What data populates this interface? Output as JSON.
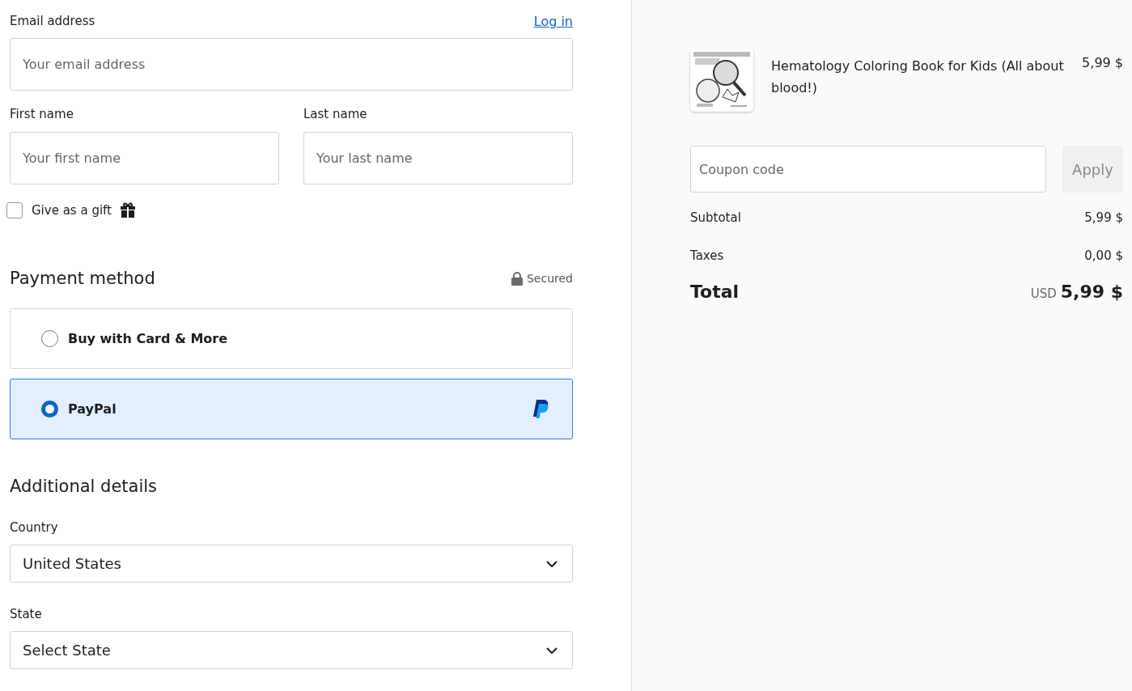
{
  "contact": {
    "email_label": "Email address",
    "login_link": "Log in",
    "email_placeholder": "Your email address",
    "first_name_label": "First name",
    "first_name_placeholder": "Your first name",
    "last_name_label": "Last name",
    "last_name_placeholder": "Your last name",
    "gift": {
      "label": "Give as a gift",
      "checked": false
    }
  },
  "payment": {
    "title": "Payment method",
    "secured": "Secured",
    "options": [
      {
        "label": "Buy with Card & More",
        "selected": false,
        "kind": "card"
      },
      {
        "label": "PayPal",
        "selected": true,
        "kind": "paypal"
      }
    ]
  },
  "details": {
    "title": "Additional details",
    "fields": [
      {
        "label": "Country",
        "value": "United States"
      },
      {
        "label": "State",
        "value": "Select State"
      }
    ]
  },
  "summary": {
    "product": {
      "title": "Hematology Coloring Book for Kids (All about blood!)",
      "price": "5,99 $"
    },
    "coupon_placeholder": "Coupon code",
    "apply_button": "Apply",
    "lines": [
      {
        "label": "Subtotal",
        "value": "5,99 $"
      },
      {
        "label": "Taxes",
        "value": "0,00 $"
      }
    ],
    "total": {
      "label": "Total",
      "currency": "USD",
      "value": "5,99 $"
    }
  }
}
